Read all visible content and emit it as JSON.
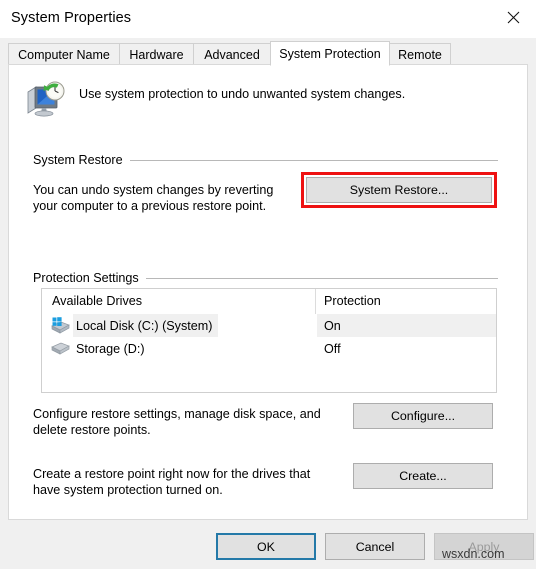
{
  "window": {
    "title": "System Properties",
    "close_icon": "close-icon"
  },
  "tabs": [
    {
      "label": "Computer Name",
      "active": false
    },
    {
      "label": "Hardware",
      "active": false
    },
    {
      "label": "Advanced",
      "active": false
    },
    {
      "label": "System Protection",
      "active": true
    },
    {
      "label": "Remote",
      "active": false
    }
  ],
  "header": {
    "icon": "system-protection-icon",
    "description": "Use system protection to undo unwanted system changes."
  },
  "system_restore": {
    "group_label": "System Restore",
    "description": "You can undo system changes by reverting your computer to a previous restore point.",
    "button_label": "System Restore..."
  },
  "protection_settings": {
    "group_label": "Protection Settings",
    "columns": [
      "Available Drives",
      "Protection"
    ],
    "rows": [
      {
        "drive": "Local Disk (C:) (System)",
        "protection": "On",
        "icon": "system-drive-icon",
        "selected": true
      },
      {
        "drive": "Storage (D:)",
        "protection": "Off",
        "icon": "drive-icon",
        "selected": false
      }
    ],
    "configure": {
      "description": "Configure restore settings, manage disk space, and delete restore points.",
      "button_label": "Configure..."
    },
    "create": {
      "description": "Create a restore point right now for the drives that have system protection turned on.",
      "button_label": "Create..."
    }
  },
  "footer": {
    "ok_label": "OK",
    "cancel_label": "Cancel",
    "apply_label": "Apply",
    "apply_disabled": true
  },
  "watermark": "wsxdn.com",
  "colors": {
    "accent_focus": "#2479a8",
    "annotation": "#ee1111",
    "button_face": "#e1e1e1",
    "panel_bg": "#ffffff",
    "dialog_bg": "#f0f0f0"
  }
}
